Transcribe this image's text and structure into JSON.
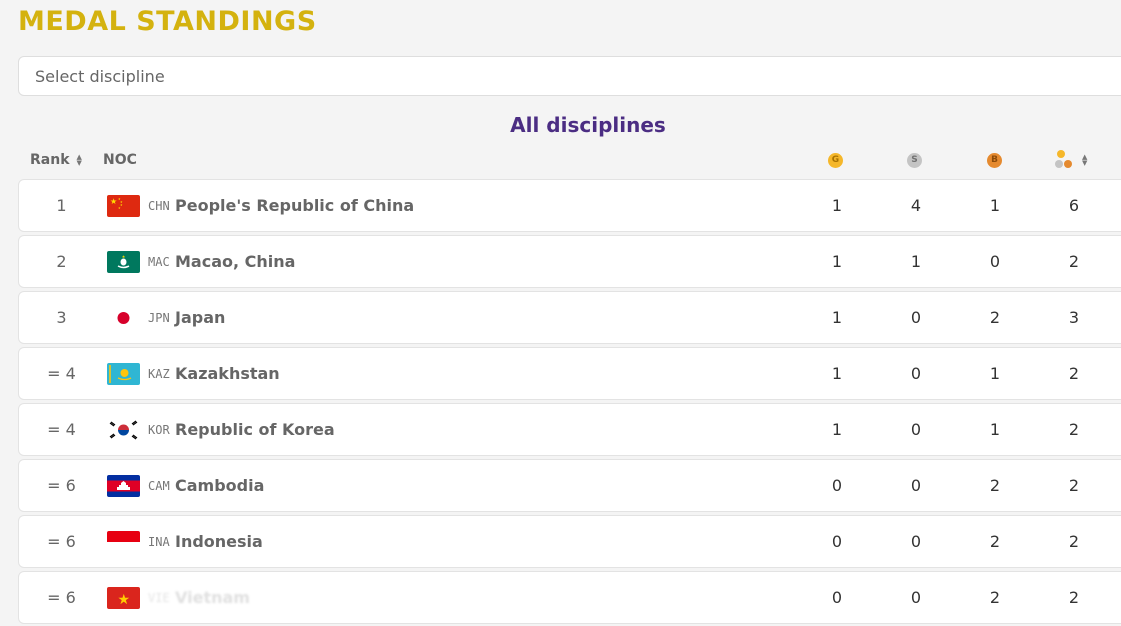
{
  "title": "MEDAL STANDINGS",
  "discipline_select": {
    "placeholder": "Select discipline"
  },
  "subtitle": "All disciplines",
  "table": {
    "headers": {
      "rank": "Rank",
      "noc": "NOC",
      "gold_icon": "G",
      "silver_icon": "S",
      "bronze_icon": "B"
    },
    "rows": [
      {
        "rank": "1",
        "code": "CHN",
        "country": "People's Republic of China",
        "gold": "1",
        "silver": "4",
        "bronze": "1",
        "total": "6"
      },
      {
        "rank": "2",
        "code": "MAC",
        "country": "Macao, China",
        "gold": "1",
        "silver": "1",
        "bronze": "0",
        "total": "2"
      },
      {
        "rank": "3",
        "code": "JPN",
        "country": "Japan",
        "gold": "1",
        "silver": "0",
        "bronze": "2",
        "total": "3"
      },
      {
        "rank": "= 4",
        "code": "KAZ",
        "country": "Kazakhstan",
        "gold": "1",
        "silver": "0",
        "bronze": "1",
        "total": "2"
      },
      {
        "rank": "= 4",
        "code": "KOR",
        "country": "Republic of Korea",
        "gold": "1",
        "silver": "0",
        "bronze": "1",
        "total": "2"
      },
      {
        "rank": "= 6",
        "code": "CAM",
        "country": "Cambodia",
        "gold": "0",
        "silver": "0",
        "bronze": "2",
        "total": "2"
      },
      {
        "rank": "= 6",
        "code": "INA",
        "country": "Indonesia",
        "gold": "0",
        "silver": "0",
        "bronze": "2",
        "total": "2"
      },
      {
        "rank": "= 6",
        "code": "VIE",
        "country": "Vietnam",
        "gold": "0",
        "silver": "0",
        "bronze": "2",
        "total": "2"
      }
    ]
  },
  "colors": {
    "title": "#d4b20f",
    "subtitle": "#4b2d83",
    "gold": "#f5b72a",
    "silver": "#c4c4c4",
    "bronze": "#e58a2f"
  }
}
